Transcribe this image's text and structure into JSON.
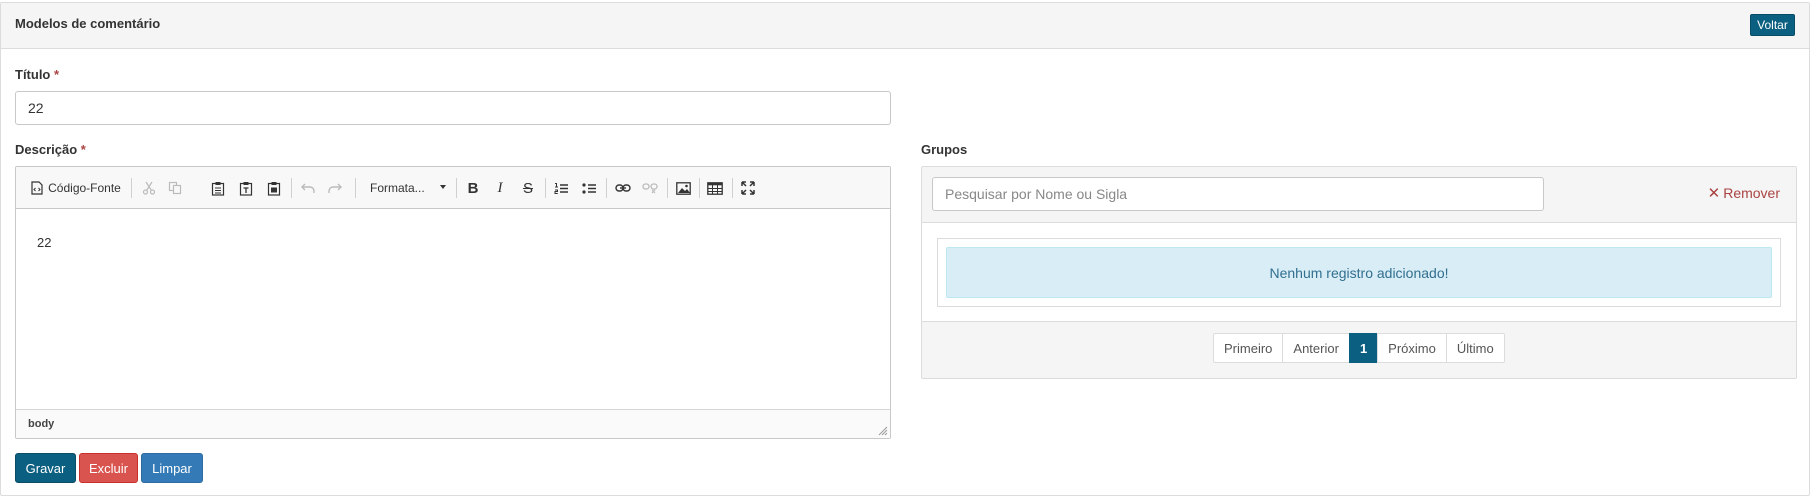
{
  "header": {
    "title": "Modelos de comentário",
    "back_label": "Voltar"
  },
  "form": {
    "titulo": {
      "label": "Título",
      "required_mark": "*",
      "value": "22"
    },
    "descricao": {
      "label": "Descrição",
      "required_mark": "*",
      "toolbar": {
        "source_label": "Código-Fonte",
        "format_label": "Formata...",
        "icons": [
          "source-icon",
          "cut-icon",
          "copy-icon",
          "paste-icon",
          "paste-text-icon",
          "paste-word-icon",
          "undo-icon",
          "redo-icon",
          "bold-icon",
          "italic-icon",
          "strike-icon",
          "numbered-list-icon",
          "bulleted-list-icon",
          "link-icon",
          "unlink-icon",
          "image-icon",
          "table-icon",
          "maximize-icon"
        ]
      },
      "content": "22",
      "status_path": "body"
    },
    "buttons": {
      "save": "Gravar",
      "delete": "Excluir",
      "clear": "Limpar"
    }
  },
  "grupos": {
    "label": "Grupos",
    "search_placeholder": "Pesquisar por Nome ou Sigla",
    "remove_label": "Remover",
    "empty_message": "Nenhum registro adicionado!",
    "pagination": {
      "first": "Primeiro",
      "prev": "Anterior",
      "current": "1",
      "next": "Próximo",
      "last": "Último"
    }
  },
  "colors": {
    "primary": "#0b5f80",
    "danger": "#d9534f",
    "info": "#337ab7",
    "alert_bg": "#d9edf7"
  }
}
